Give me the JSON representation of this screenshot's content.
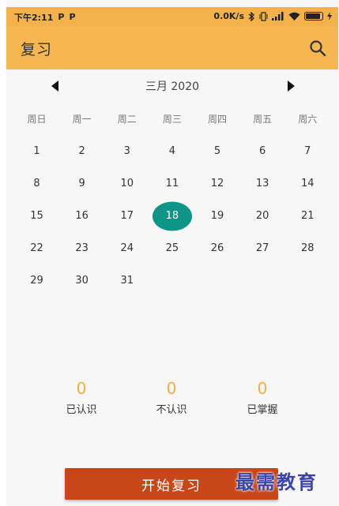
{
  "status_bar": {
    "time": "下午2:11",
    "app_badge_1": "P",
    "app_badge_2": "P",
    "network_speed": "0.0K/s",
    "icons": [
      "bluetooth-icon",
      "vibrate-icon",
      "signal-hd-icon",
      "wifi-icon",
      "battery-icon",
      "charging-icon"
    ]
  },
  "app_bar": {
    "title": "复习",
    "search_icon": "search-icon"
  },
  "calendar": {
    "month_title": "三月 2020",
    "prev_icon": "triangle-left-icon",
    "next_icon": "triangle-right-icon",
    "weekdays": [
      "周日",
      "周一",
      "周二",
      "周三",
      "周四",
      "周五",
      "周六"
    ],
    "days": [
      "1",
      "2",
      "3",
      "4",
      "5",
      "6",
      "7",
      "8",
      "9",
      "10",
      "11",
      "12",
      "13",
      "14",
      "15",
      "16",
      "17",
      "18",
      "19",
      "20",
      "21",
      "22",
      "23",
      "24",
      "25",
      "26",
      "27",
      "28",
      "29",
      "30",
      "31"
    ],
    "selected_day": "18",
    "selected_color": "#0f9488"
  },
  "stats": [
    {
      "value": "0",
      "label": "已认识"
    },
    {
      "value": "0",
      "label": "不认识"
    },
    {
      "value": "0",
      "label": "已掌握"
    }
  ],
  "start_button": {
    "label": "开始复习",
    "color": "#c84719"
  },
  "watermark": "最需教育",
  "colors": {
    "accent": "#f6b651",
    "stat_value": "#f0ae45"
  }
}
